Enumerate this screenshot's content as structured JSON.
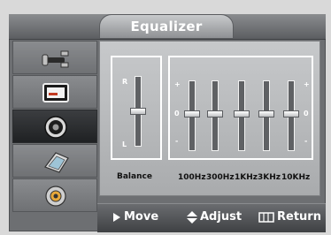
{
  "title": "Equalizer",
  "sidebar": {
    "items": [
      {
        "icon": "plug-icon"
      },
      {
        "icon": "picture-icon"
      },
      {
        "icon": "speaker-icon"
      },
      {
        "icon": "channel-icon"
      },
      {
        "icon": "gear-icon"
      }
    ]
  },
  "balance": {
    "label": "Balance",
    "top_label": "R",
    "bottom_label": "L",
    "value": 0.5
  },
  "equalizer": {
    "plus_label": "+",
    "zero_label": "0",
    "minus_label": "-",
    "bands": [
      {
        "label": "100Hz",
        "value": 0
      },
      {
        "label": "300Hz",
        "value": 0
      },
      {
        "label": "1KHz",
        "value": 0
      },
      {
        "label": "3KHz",
        "value": 0
      },
      {
        "label": "10KHz",
        "value": 0
      }
    ]
  },
  "footer": {
    "move": "Move",
    "adjust": "Adjust",
    "return": "Return"
  }
}
